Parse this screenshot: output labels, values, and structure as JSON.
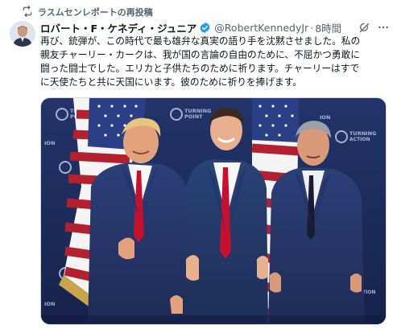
{
  "repost": {
    "label": "ラスムセンレポートの再投稿"
  },
  "post": {
    "author_name": "ロバート・F・ケネディ・ジュニア",
    "handle": "@RobertKennedyJr",
    "separator": "·",
    "time": "8時間",
    "text": "再び、銃弾が、この時代で最も雄弁な真実の語り手を沈黙させました。私の\n親友チャーリー・カークは、我が国の言論の自由のために、不屈かつ勇敢に\n闘った闘士でした。エリカと子供たちのために祈ります。チャーリーはすで\nに天使たちと共に天国にいます。彼のために祈りを捧げます。"
  },
  "media": {
    "backdrop_text_line1": "TURNING",
    "backdrop_text_line2": "POINT",
    "backdrop_text_action": "ACTION",
    "backdrop_text_short": "ION"
  },
  "colors": {
    "verified": "#1d9bf0",
    "muted": "#536471",
    "backdrop": "#1c2d5e"
  },
  "icons": [
    "repost-icon",
    "verified-icon",
    "grok-icon",
    "more-icon"
  ]
}
